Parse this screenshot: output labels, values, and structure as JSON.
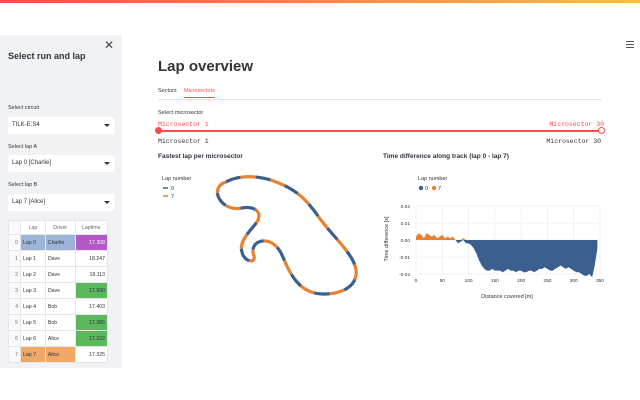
{
  "sidebar": {
    "title": "Select run and lap",
    "circuit_label": "Select circuit",
    "circuit_value": "TILK-E:S4",
    "lapA_label": "Select lap A",
    "lapA_value": "Lap 0 [Charlie]",
    "lapB_label": "Select lap B",
    "lapB_value": "Lap 7 [Alice]",
    "table": {
      "headers": [
        "",
        "Lap",
        "Driver",
        "Laptime"
      ],
      "rows": [
        {
          "idx": "0",
          "lap": "Lap 0",
          "driver": "Charlie",
          "time": "17.308"
        },
        {
          "idx": "1",
          "lap": "Lap 1",
          "driver": "Dave",
          "time": "18.247"
        },
        {
          "idx": "2",
          "lap": "Lap 2",
          "driver": "Dave",
          "time": "18.113"
        },
        {
          "idx": "3",
          "lap": "Lap 3",
          "driver": "Dave",
          "time": "17.990"
        },
        {
          "idx": "4",
          "lap": "Lap 4",
          "driver": "Bob",
          "time": "17.403"
        },
        {
          "idx": "5",
          "lap": "Lap 5",
          "driver": "Bob",
          "time": "17.385"
        },
        {
          "idx": "6",
          "lap": "Lap 6",
          "driver": "Alice",
          "time": "17.322"
        },
        {
          "idx": "7",
          "lap": "Lap 7",
          "driver": "Alice",
          "time": "17.325"
        }
      ]
    }
  },
  "main": {
    "title": "Lap overview",
    "tabs": [
      "Sectors",
      "Microsectors"
    ],
    "active_tab": "Microsectors",
    "slider": {
      "label": "Select microsector",
      "min_value": "Microsector 1",
      "max_value": "Microsector 30",
      "min_label": "Microsector 1",
      "max_label": "Microsector 30"
    },
    "map_title": "Fastest lap per microsector",
    "diff_title": "Time difference along track (lap 0 - lap 7)"
  },
  "colors": {
    "accent": "#ff4b4b",
    "lap_a": "#3a5f8f",
    "lap_b": "#e8812f",
    "purple": "#b358c7",
    "green": "#5cb85c",
    "orange_cell": "#f0a867"
  },
  "chart_data": [
    {
      "type": "line",
      "title": "Fastest lap per microsector",
      "legend_title": "Lap number",
      "series": [
        {
          "name": "0",
          "color": "#3a5f8f"
        },
        {
          "name": "7",
          "color": "#e8812f"
        }
      ],
      "microsector_fastest": [
        "0",
        "7",
        "0",
        "7",
        "0",
        "7",
        "0",
        "7",
        "0",
        "7",
        "0",
        "7",
        "0",
        "7",
        "0",
        "7",
        "0",
        "7",
        "0",
        "7",
        "0",
        "7",
        "0",
        "7",
        "0",
        "7",
        "0",
        "7",
        "0",
        "7"
      ]
    },
    {
      "type": "area",
      "title": "Time difference along track (lap 0 - lap 7)",
      "legend_title": "Lap number",
      "legend": [
        "0",
        "7"
      ],
      "xlabel": "Distance covered [m]",
      "ylabel": "Time difference [s]",
      "xlim": [
        0,
        350
      ],
      "ylim": [
        -0.02,
        0.02
      ],
      "xticks": [
        0,
        50,
        100,
        150,
        200,
        250,
        300,
        350
      ],
      "yticks": [
        "0.02",
        "0.01",
        "0.00",
        "-0.01",
        "-0.02"
      ],
      "x": [
        0,
        5,
        10,
        15,
        20,
        25,
        30,
        35,
        40,
        45,
        50,
        55,
        60,
        65,
        70,
        75,
        80,
        85,
        90,
        95,
        100,
        105,
        110,
        115,
        120,
        125,
        130,
        135,
        140,
        145,
        150,
        155,
        160,
        165,
        170,
        175,
        180,
        185,
        190,
        195,
        200,
        205,
        210,
        215,
        220,
        225,
        230,
        235,
        240,
        245,
        250,
        255,
        260,
        265,
        270,
        275,
        280,
        285,
        290,
        295,
        300,
        305,
        310,
        315,
        320,
        325,
        330,
        335,
        340,
        345
      ],
      "y": [
        0.002,
        0.004,
        0.003,
        0.001,
        0.004,
        0.003,
        0.002,
        0.003,
        0.001,
        0.002,
        0.003,
        0.001,
        0.002,
        0.001,
        0.002,
        0.0,
        -0.002,
        -0.001,
        0.001,
        -0.002,
        -0.002,
        -0.003,
        -0.005,
        -0.008,
        -0.012,
        -0.015,
        -0.017,
        -0.018,
        -0.018,
        -0.017,
        -0.018,
        -0.018,
        -0.018,
        -0.019,
        -0.018,
        -0.017,
        -0.018,
        -0.018,
        -0.019,
        -0.018,
        -0.018,
        -0.019,
        -0.019,
        -0.018,
        -0.018,
        -0.019,
        -0.018,
        -0.017,
        -0.017,
        -0.016,
        -0.017,
        -0.018,
        -0.018,
        -0.017,
        -0.016,
        -0.015,
        -0.016,
        -0.017,
        -0.016,
        -0.017,
        -0.018,
        -0.019,
        -0.019,
        -0.02,
        -0.021,
        -0.021,
        -0.02,
        -0.022,
        -0.015,
        -0.005
      ]
    }
  ]
}
